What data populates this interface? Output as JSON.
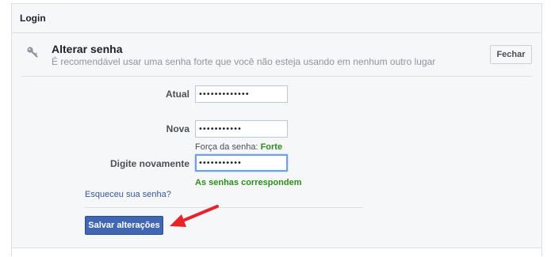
{
  "panel": {
    "title": "Login"
  },
  "section": {
    "icon": "key-icon",
    "title": "Alterar senha",
    "description": "É recomendável usar uma senha forte que você não esteja usando em nenhum outro lugar",
    "close_label": "Fechar"
  },
  "form": {
    "current": {
      "label": "Atual",
      "value": "•••••••••••••"
    },
    "new": {
      "label": "Nova",
      "value": "•••••••••••"
    },
    "confirm": {
      "label": "Digite novamente",
      "value": "•••••••••••"
    },
    "strength": {
      "prefix": "Força da senha:",
      "value": "Forte"
    },
    "match_message": "As senhas correspondem",
    "forgot_link": "Esqueceu sua senha?",
    "save_label": "Salvar alterações"
  },
  "colors": {
    "accent": "#4267b2",
    "link": "#365899",
    "success": "#2a8e1b",
    "annotation_arrow": "#e8232a"
  }
}
